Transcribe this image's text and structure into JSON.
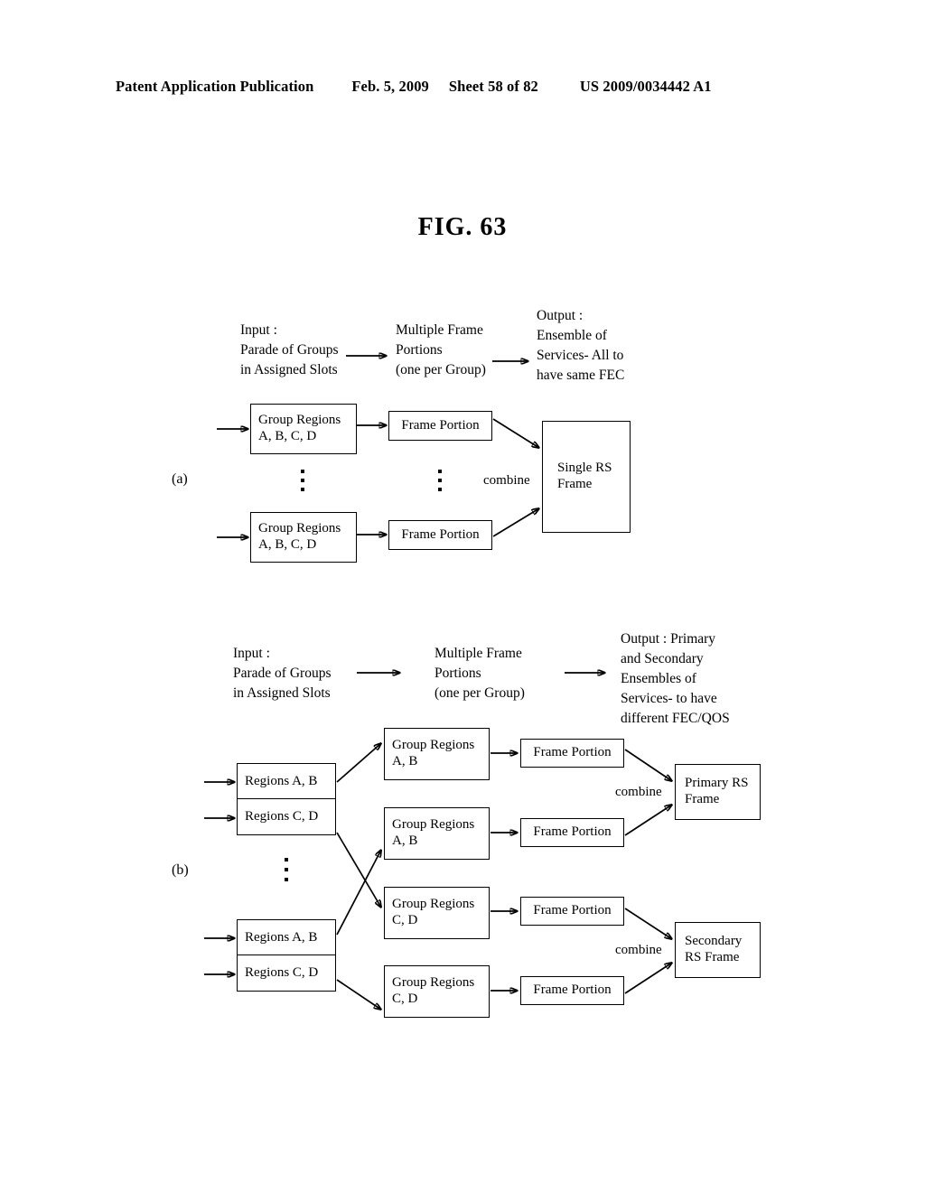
{
  "header": {
    "publication": "Patent Application Publication",
    "date": "Feb. 5, 2009",
    "sheet": "Sheet 58 of 82",
    "number": "US 2009/0034442 A1"
  },
  "figure": {
    "title": "FIG. 63"
  },
  "diagram_a": {
    "label": "(a)",
    "captions": {
      "input": [
        "Input :",
        "Parade of Groups",
        "in Assigned Slots"
      ],
      "middle": [
        "Multiple Frame",
        "Portions",
        "(one per Group)"
      ],
      "output": [
        "Output :",
        "Ensemble of",
        "Services- All to",
        "have same FEC"
      ]
    },
    "group_boxes": [
      {
        "lines": [
          "Group Regions",
          "A, B, C, D"
        ]
      },
      {
        "lines": [
          "Group Regions",
          "A, B, C, D"
        ]
      }
    ],
    "frame_portions": [
      {
        "label": "Frame Portion"
      },
      {
        "label": "Frame Portion"
      }
    ],
    "combine_label": "combine",
    "output_box": {
      "lines": [
        "Single RS",
        "Frame"
      ]
    }
  },
  "diagram_b": {
    "label": "(b)",
    "captions": {
      "input": [
        "Input :",
        "Parade of Groups",
        "in Assigned Slots"
      ],
      "middle": [
        "Multiple Frame",
        "Portions",
        "(one per Group)"
      ],
      "output": [
        "Output : Primary",
        "and Secondary",
        "Ensembles of",
        "Services- to have",
        "different FEC/QOS"
      ]
    },
    "region_stacks": [
      {
        "top": "Regions A, B",
        "bottom": "Regions C, D"
      },
      {
        "top": "Regions A, B",
        "bottom": "Regions C, D"
      }
    ],
    "group_boxes": [
      {
        "lines": [
          "Group Regions",
          "A, B"
        ]
      },
      {
        "lines": [
          "Group Regions",
          "A, B"
        ]
      },
      {
        "lines": [
          "Group Regions",
          "C, D"
        ]
      },
      {
        "lines": [
          "Group Regions",
          "C, D"
        ]
      }
    ],
    "frame_portions": [
      {
        "label": "Frame Portion"
      },
      {
        "label": "Frame Portion"
      },
      {
        "label": "Frame Portion"
      },
      {
        "label": "Frame Portion"
      }
    ],
    "combine_labels": [
      "combine",
      "combine"
    ],
    "output_boxes": [
      {
        "lines": [
          "Primary RS",
          "Frame"
        ]
      },
      {
        "lines": [
          "Secondary",
          "RS Frame"
        ]
      }
    ]
  }
}
